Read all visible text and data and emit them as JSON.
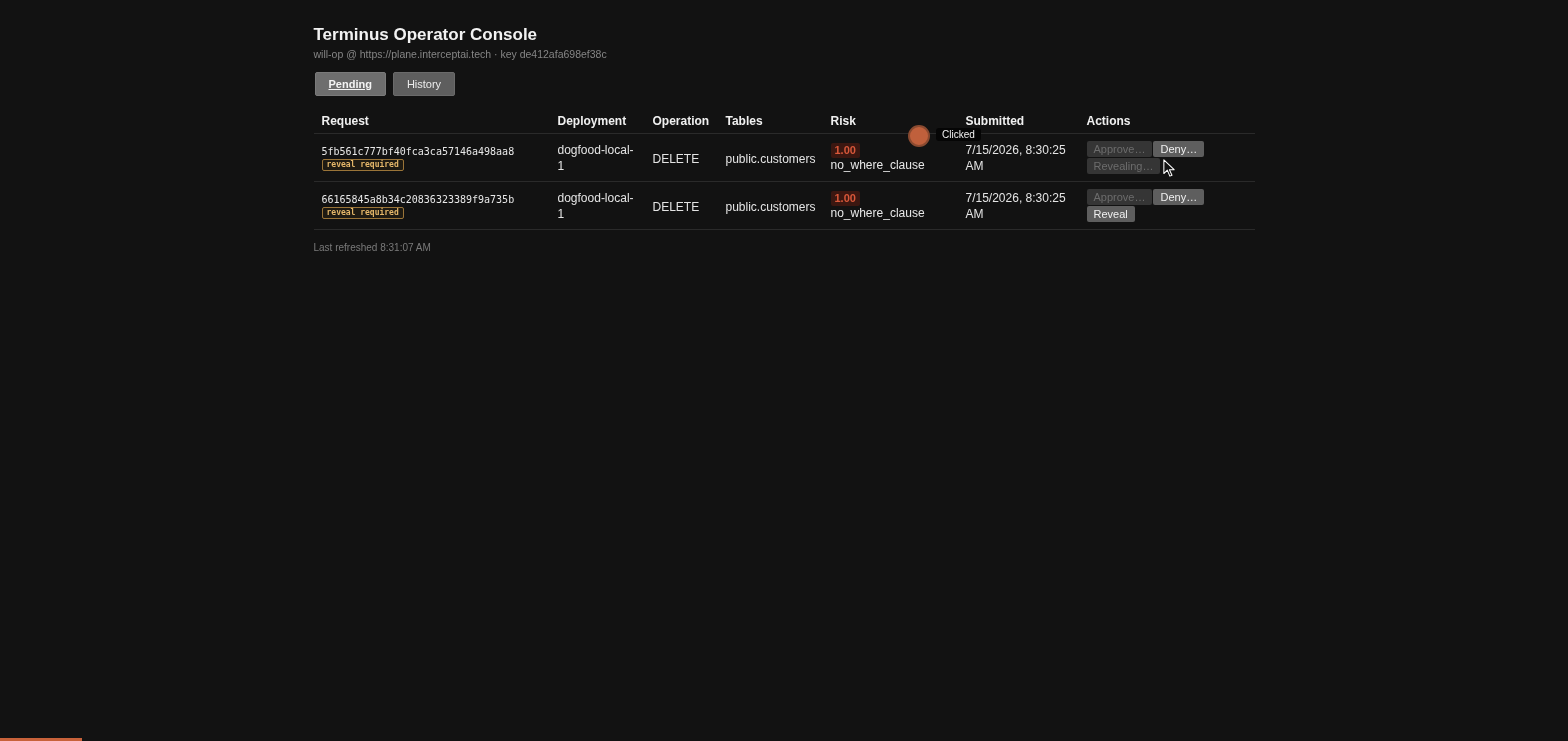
{
  "header": {
    "title": "Terminus Operator Console",
    "subtitle": "will-op @ https://plane.interceptai.tech · key de412afa698ef38c"
  },
  "tabs": [
    {
      "label": "Pending",
      "selected": true
    },
    {
      "label": "History",
      "selected": false
    }
  ],
  "table": {
    "columns": [
      "Request",
      "Deployment",
      "Operation",
      "Tables",
      "Risk",
      "Submitted",
      "Actions"
    ],
    "rows": [
      {
        "request_id": "5fb561c777bf40fca3ca57146a498aa8",
        "badge": "reveal required",
        "deployment": "dogfood-local-1",
        "operation": "DELETE",
        "tables": "public.customers",
        "risk_score": "1.00",
        "risk_reason": "no_where_clause",
        "submitted": "7/15/2026, 8:30:25 AM",
        "actions": [
          {
            "label": "Approve…",
            "disabled": true
          },
          {
            "label": "Deny…",
            "disabled": false
          },
          {
            "label": "Revealing…",
            "disabled": true
          }
        ]
      },
      {
        "request_id": "66165845a8b34c20836323389f9a735b",
        "badge": "reveal required",
        "deployment": "dogfood-local-1",
        "operation": "DELETE",
        "tables": "public.customers",
        "risk_score": "1.00",
        "risk_reason": "no_where_clause",
        "submitted": "7/15/2026, 8:30:25 AM",
        "actions": [
          {
            "label": "Approve…",
            "disabled": true
          },
          {
            "label": "Deny…",
            "disabled": false
          },
          {
            "label": "Reveal",
            "disabled": false
          }
        ]
      }
    ]
  },
  "status": {
    "text": "Last refreshed 8:31:07 AM"
  },
  "click_indicator": {
    "label": "Clicked"
  },
  "progress_bar": {
    "level": 0.052
  }
}
